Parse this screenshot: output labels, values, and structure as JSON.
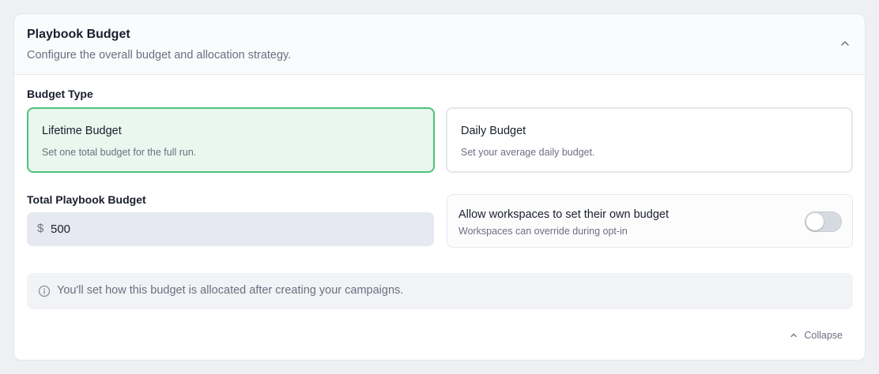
{
  "header": {
    "title": "Playbook Budget",
    "subtitle": "Configure the overall budget and allocation strategy."
  },
  "budget_type": {
    "label": "Budget Type",
    "options": [
      {
        "title": "Lifetime Budget",
        "description": "Set one total budget for the full run.",
        "selected": true
      },
      {
        "title": "Daily Budget",
        "description": "Set your average daily budget.",
        "selected": false
      }
    ]
  },
  "total_budget": {
    "label": "Total Playbook Budget",
    "currency_symbol": "$",
    "value": "500"
  },
  "workspace_toggle": {
    "title": "Allow workspaces to set their own budget",
    "description": "Workspaces can override during opt-in",
    "enabled": false
  },
  "info": {
    "text": "You'll set how this budget is allocated after creating your campaigns."
  },
  "footer": {
    "collapse_label": "Collapse"
  },
  "colors": {
    "selected_border": "#4fc17b",
    "selected_bg": "#e9f7ee",
    "input_bg": "#e6e9f1",
    "muted_text": "#6b7080"
  }
}
